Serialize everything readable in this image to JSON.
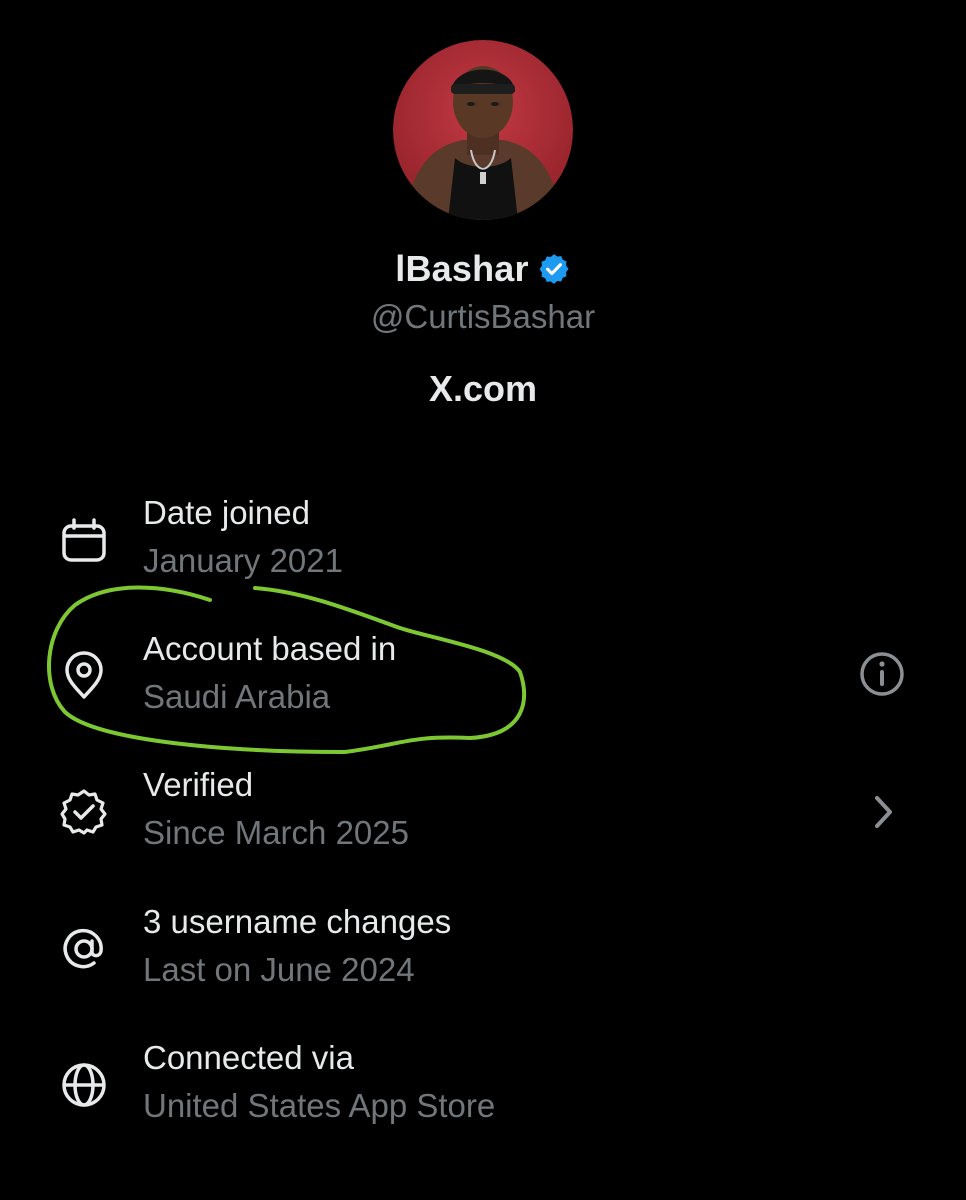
{
  "profile": {
    "display_name": "lBashar",
    "handle": "@CurtisBashar",
    "site": "X.com",
    "verified_badge_icon": "verified-badge-icon",
    "badge_color": "#1d9bf0"
  },
  "rows": [
    {
      "icon": "calendar-icon",
      "title": "Date joined",
      "subtitle": "January 2021",
      "trailing": null
    },
    {
      "icon": "location-pin-icon",
      "title": "Account based in",
      "subtitle": "Saudi Arabia",
      "trailing": "info-icon"
    },
    {
      "icon": "verified-seal-icon",
      "title": "Verified",
      "subtitle": "Since March 2025",
      "trailing": "chevron-right-icon"
    },
    {
      "icon": "at-sign-icon",
      "title": "3 username changes",
      "subtitle": "Last on June 2024",
      "trailing": null
    },
    {
      "icon": "globe-icon",
      "title": "Connected via",
      "subtitle": "United States App Store",
      "trailing": null
    }
  ],
  "annotation": {
    "type": "hand-drawn-circle",
    "color": "#7dc832",
    "target": "Account based in"
  },
  "colors": {
    "background": "#000000",
    "primary_text": "#e7e9ea",
    "secondary_text": "#71767b"
  }
}
